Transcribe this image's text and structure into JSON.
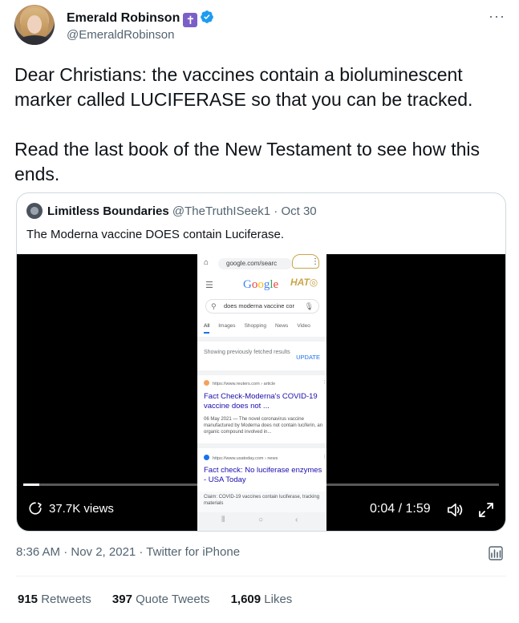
{
  "author": {
    "name": "Emerald Robinson",
    "handle": "@EmeraldRobinson"
  },
  "tweet": {
    "paragraphs": [
      "Dear Christians: the vaccines contain a bioluminescent marker called LUCIFERASE so that you can be tracked.",
      "Read the last book of the New Testament to see how this ends."
    ]
  },
  "quoted": {
    "name": "Limitless Boundaries",
    "handle": "@TheTruthISeek1",
    "date": "· Oct 30",
    "text": "The Moderna vaccine DOES contain Luciferase."
  },
  "video": {
    "views": "37.7K views",
    "time": "0:04 / 1:59",
    "progress_fraction": 0.034,
    "phone_screen": {
      "url": "google.com/searc",
      "logo_letters": [
        "G",
        "o",
        "o",
        "g",
        "l",
        "e"
      ],
      "watermark": "HAT",
      "search_query": "does moderna vaccine cor",
      "tabs": [
        "All",
        "Images",
        "Shopping",
        "News",
        "Video"
      ],
      "fetched_notice": "Showing previously fetched results",
      "update_label": "UPDATE",
      "results": [
        {
          "source": "https://www.reuters.com › article",
          "title": "Fact Check-Moderna's COVID-19 vaccine does not ...",
          "snippet": "06 May 2021 — The novel coronavirus vaccine manufactured by Moderna does not contain luciferin, an organic compound involved in..."
        },
        {
          "source": "https://www.usatoday.com › news",
          "title": "Fact check: No luciferase enzymes - USA Today",
          "snippet": ""
        }
      ],
      "claim": "Claim: COVID-19 vaccines contain luciferase, tracking materials"
    }
  },
  "meta": {
    "timestamp": "8:36 AM · Nov 2, 2021 · Twitter for iPhone"
  },
  "stats": {
    "retweets_count": "915",
    "retweets_label": "Retweets",
    "quotes_count": "397",
    "quotes_label": "Quote Tweets",
    "likes_count": "1,609",
    "likes_label": "Likes"
  },
  "icons": {
    "badge": "cross-icon",
    "verified": "verified-icon",
    "more": "more-icon",
    "loop": "loop-icon",
    "volume": "volume-icon",
    "fullscreen": "fullscreen-icon",
    "analytics": "analytics-icon"
  },
  "colors": {
    "verified_blue": "#1d9bf0",
    "badge_purple": "#7b5fc8",
    "text_primary": "#0f1419",
    "text_secondary": "#536471"
  }
}
